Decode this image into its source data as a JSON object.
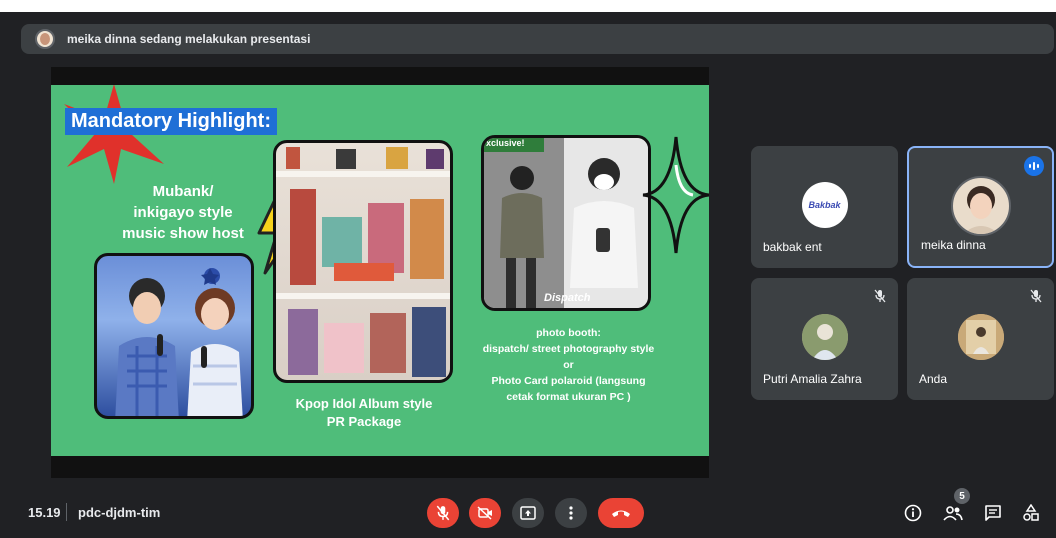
{
  "banner": {
    "text": "meika dinna sedang melakukan presentasi"
  },
  "slide": {
    "title": "Mandatory Highlight:",
    "host_lines": [
      "Mubank/",
      "inkigayo style",
      "music show host"
    ],
    "album_caption": [
      "Kpop Idol Album style",
      "PR Package"
    ],
    "booth_caption": [
      "photo booth:",
      "dispatch/ street photography style",
      "or",
      "Photo Card polaroid (langsung",
      "cetak format ukuran PC )"
    ],
    "exclusive_label": "xclusive!",
    "dispatch_label": "Dispatch",
    "colors": {
      "background": "#4fbd7a",
      "title_box": "#1f6fd6",
      "accent_red": "#e0312b",
      "bolt": "#f7d21b"
    }
  },
  "participants": [
    {
      "name": "bakbak ent",
      "logo_text": "Bakbak",
      "muted": false,
      "speaking": false
    },
    {
      "name": "meika dinna",
      "muted": false,
      "speaking": true
    },
    {
      "name": "Putri Amalia Zahra",
      "muted": true,
      "speaking": false
    },
    {
      "name": "Anda",
      "muted": true,
      "speaking": false
    }
  ],
  "bottom_bar": {
    "time": "15.19",
    "meeting_code": "pdc-djdm-tim",
    "people_count": "5",
    "controls": [
      "mic-off-icon",
      "camera-off-icon",
      "present-icon",
      "more-options-icon",
      "hang-up-icon"
    ],
    "right_icons": [
      "info-icon",
      "people-icon",
      "chat-icon",
      "activities-icon"
    ]
  }
}
